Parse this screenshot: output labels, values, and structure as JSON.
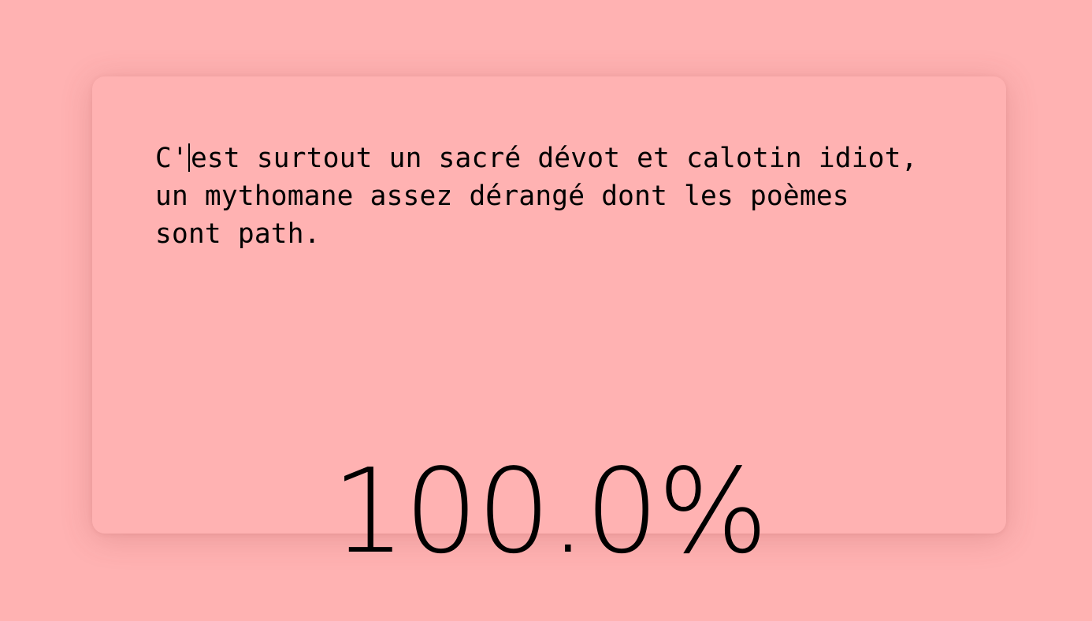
{
  "typing_test": {
    "text_before_caret": "C'",
    "text_after_caret": "est surtout un sacré dévot et calotin idiot,\nun mythomane assez dérangé dont les poèmes\nsont path."
  },
  "result": {
    "accuracy": "100.0%"
  },
  "colors": {
    "background": "#ffb2b2",
    "text": "#000000"
  }
}
